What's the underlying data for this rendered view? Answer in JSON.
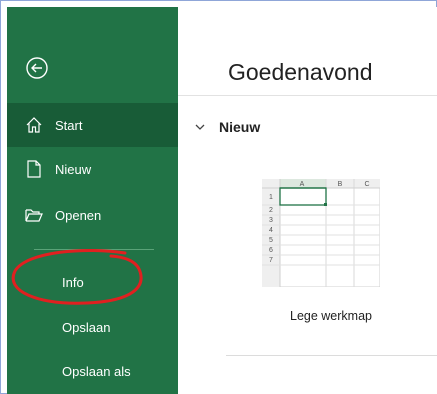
{
  "sidebar": {
    "back_icon": "back-arrow-circle-icon",
    "items": [
      {
        "label": "Start",
        "icon": "home-icon"
      },
      {
        "label": "Nieuw",
        "icon": "new-document-icon"
      },
      {
        "label": "Openen",
        "icon": "folder-open-icon"
      },
      {
        "label": "Info"
      },
      {
        "label": "Opslaan"
      },
      {
        "label": "Opslaan als"
      }
    ]
  },
  "main": {
    "greeting": "Goedenavond",
    "section_title": "Nieuw",
    "template": {
      "label": "Lege werkmap",
      "columns": [
        "A",
        "B",
        "C"
      ],
      "rows": [
        "1",
        "2",
        "3",
        "4",
        "5",
        "6",
        "7"
      ]
    }
  },
  "colors": {
    "sidebar_bg": "#217346",
    "sidebar_active": "#185c37",
    "annotation": "#e02020"
  }
}
